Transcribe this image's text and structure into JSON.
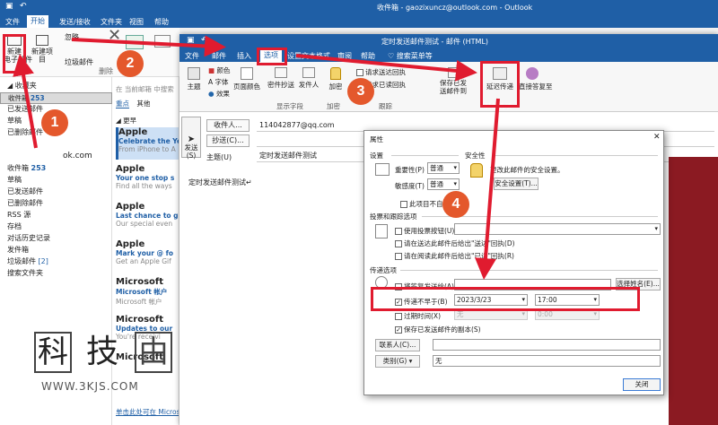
{
  "main_window": {
    "title": "收件箱 - gaozixuncz@outlook.com - Outlook",
    "tabs": [
      "文件",
      "开始",
      "发送/接收",
      "文件夹",
      "视图",
      "帮助"
    ],
    "active_tab": "开始",
    "search_tab": "搜索菜单等"
  },
  "ribbon": {
    "new_mail": "新建\n电子邮件",
    "new_item": "新建项目",
    "ignore": "忽略",
    "junk": "垃圾邮件",
    "delete": "删除"
  },
  "folders": {
    "favorites": "收藏夹",
    "items": [
      {
        "label": "收件箱",
        "count": "253"
      },
      {
        "label": "已发送邮件"
      },
      {
        "label": "草稿"
      },
      {
        "label": "已删除邮件"
      }
    ],
    "account": "ok.com",
    "account_items": [
      {
        "label": "收件箱",
        "count": "253"
      },
      {
        "label": "草稿"
      },
      {
        "label": "已发送邮件"
      },
      {
        "label": "已删除邮件"
      },
      {
        "label": "RSS 源"
      },
      {
        "label": "存档"
      },
      {
        "label": "对话历史记录"
      },
      {
        "label": "发件箱"
      },
      {
        "label": "垃圾邮件",
        "count": "[2]"
      },
      {
        "label": "搜索文件夹"
      }
    ]
  },
  "message_list": {
    "search_placeholder": "在 当前邮箱 中搜索",
    "focused_tab": "重点",
    "other_tab": "其他",
    "group": "更早",
    "messages": [
      {
        "sender": "Apple",
        "subject": "Celebrate the Ye",
        "preview": "From iPhone to A"
      },
      {
        "sender": "Apple",
        "subject": "Your one stop s",
        "preview": "Find all the ways"
      },
      {
        "sender": "Apple",
        "subject": "Last chance to g",
        "preview": "Our special even"
      },
      {
        "sender": "Apple",
        "subject": "Mark your @ fo",
        "preview": "Get an Apple Gif"
      },
      {
        "sender": "Microsoft",
        "subject": "Microsoft 帐户",
        "preview": "Microsoft 帐户"
      },
      {
        "sender": "Microsoft",
        "subject": "Updates to our",
        "preview": "You're receivi"
      },
      {
        "sender": "Microsoft",
        "subject": "",
        "preview": ""
      }
    ],
    "footer": "单击此处可在 Microsoft"
  },
  "compose": {
    "title": "定时发送邮件测试 - 邮件 (HTML)",
    "tabs": [
      "文件",
      "邮件",
      "插入",
      "选项",
      "设置文本格式",
      "审阅",
      "帮助"
    ],
    "active_tab": "选项",
    "search_tab": "搜索菜单等",
    "ribbon": {
      "theme": "主题",
      "colors": "颜色",
      "fonts": "字体",
      "effects": "效果",
      "page_color": "页面颜色",
      "bcc": "密件抄送",
      "from": "发件人",
      "show_fields": "显示字段",
      "encrypt": "加密",
      "encrypt_group": "加密",
      "request_delivery": "请求送达回执",
      "request_read": "请求已读回执",
      "tracking": "跟踪",
      "save_sent": "保存已发送邮件到",
      "delay_delivery": "延迟传递",
      "direct_replies": "直接答复至",
      "more_options": "其他选项"
    },
    "send": "发送\n(S)",
    "to_label": "收件人...",
    "to_value": "114042877@qq.com",
    "cc_label": "抄送(C)...",
    "subject_label": "主题(U)",
    "subject_value": "定时发送邮件测试",
    "body": "定时发送邮件测试↵"
  },
  "dialog": {
    "title": "属性",
    "settings": "设置",
    "importance_label": "重要性(P)",
    "importance_value": "普通",
    "sensitivity_label": "敏感度(T)",
    "sensitivity_value": "普通",
    "security": "安全性",
    "security_text": "更改此邮件的安全设置。",
    "security_button": "安全设置(T)...",
    "autoarchive": "此项目不自动存档",
    "voting_section": "投票和跟踪选项",
    "use_voting": "使用投票按钮(U)",
    "request_delivery": "请在送达此邮件后给出\"送达\"回执(D)",
    "request_read": "请在阅读此邮件后给出\"已读\"回执(R)",
    "delivery_section": "传递选项",
    "replies_to": "将答复发送给(A)",
    "select_names": "选择姓名(E)...",
    "do_not_deliver": "传递不早于(B)",
    "date_value": "2023/3/23",
    "time_value": "17:00",
    "expires": "过期时间(X)",
    "expires_date": "无",
    "expires_time": "0:00",
    "save_copy": "保存已发送邮件的副本(S)",
    "contacts_button": "联系人(C)...",
    "categories_button": "类别(G)",
    "categories_value": "无",
    "close_button": "关闭"
  },
  "annotations": [
    "1",
    "2",
    "3",
    "4"
  ],
  "watermark": {
    "chars": [
      "科",
      "技",
      "由"
    ],
    "url": "WWW.3KJS.COM"
  },
  "colors": {
    "outlook_blue": "#1f5fa6",
    "annotation_orange": "#e4582c",
    "highlight_red": "#e01b2f"
  }
}
